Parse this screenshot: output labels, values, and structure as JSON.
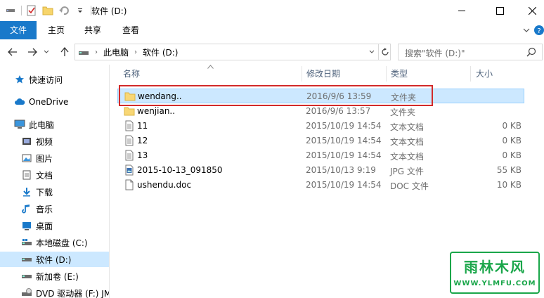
{
  "window": {
    "title": "软件 (D:)",
    "minimize_label": "",
    "maximize_label": "",
    "close_label": ""
  },
  "ribbon": {
    "tabs": [
      {
        "label": "文件"
      },
      {
        "label": "主页"
      },
      {
        "label": "共享"
      },
      {
        "label": "查看"
      }
    ]
  },
  "address": {
    "crumbs": [
      "此电脑",
      "软件 (D:)"
    ]
  },
  "search": {
    "placeholder": "搜索\"软件 (D:)\""
  },
  "sidebar": {
    "items": [
      {
        "label": "快速访问",
        "icon": "star-icon"
      },
      {
        "label": "OneDrive",
        "icon": "cloud-icon"
      },
      {
        "label": "此电脑",
        "icon": "computer-icon"
      },
      {
        "label": "视频",
        "icon": "video-icon"
      },
      {
        "label": "图片",
        "icon": "pictures-icon"
      },
      {
        "label": "文档",
        "icon": "documents-icon"
      },
      {
        "label": "下载",
        "icon": "download-icon"
      },
      {
        "label": "音乐",
        "icon": "music-icon"
      },
      {
        "label": "桌面",
        "icon": "desktop-icon"
      },
      {
        "label": "本地磁盘 (C:)",
        "icon": "drive-c-icon"
      },
      {
        "label": "软件 (D:)",
        "icon": "drive-icon",
        "selected": true
      },
      {
        "label": "新加卷 (E:)",
        "icon": "drive-icon"
      },
      {
        "label": "DVD 驱动器 (F:) JM",
        "icon": "dvd-icon"
      }
    ]
  },
  "columns": {
    "name": "名称",
    "date": "修改日期",
    "type": "类型",
    "size": "大小"
  },
  "files": [
    {
      "name": "wendang..",
      "date": "2016/9/6 13:59",
      "type": "文件夹",
      "size": "",
      "icon": "folder-icon",
      "selected": true
    },
    {
      "name": "wenjian..",
      "date": "2016/9/6 13:57",
      "type": "文件夹",
      "size": "",
      "icon": "folder-icon"
    },
    {
      "name": "11",
      "date": "2015/10/19 14:54",
      "type": "文本文档",
      "size": "0 KB",
      "icon": "text-file-icon"
    },
    {
      "name": "12",
      "date": "2015/10/19 14:54",
      "type": "文本文档",
      "size": "0 KB",
      "icon": "text-file-icon"
    },
    {
      "name": "13",
      "date": "2015/10/19 14:54",
      "type": "文本文档",
      "size": "0 KB",
      "icon": "text-file-icon"
    },
    {
      "name": "2015-10-13_091850",
      "date": "2015/10/13 9:19",
      "type": "JPG 文件",
      "size": "55 KB",
      "icon": "image-file-icon"
    },
    {
      "name": "ushendu.doc",
      "date": "2015/10/19 14:54",
      "type": "DOC 文件",
      "size": "10 KB",
      "icon": "doc-file-icon"
    }
  ],
  "watermark": {
    "title": "雨林木风",
    "url": "WWW.YLMFU.COM"
  },
  "colors": {
    "accent": "#1979ca",
    "selection": "#cce8ff",
    "highlight": "#d22a2a",
    "watermark": "#1aa64a"
  }
}
